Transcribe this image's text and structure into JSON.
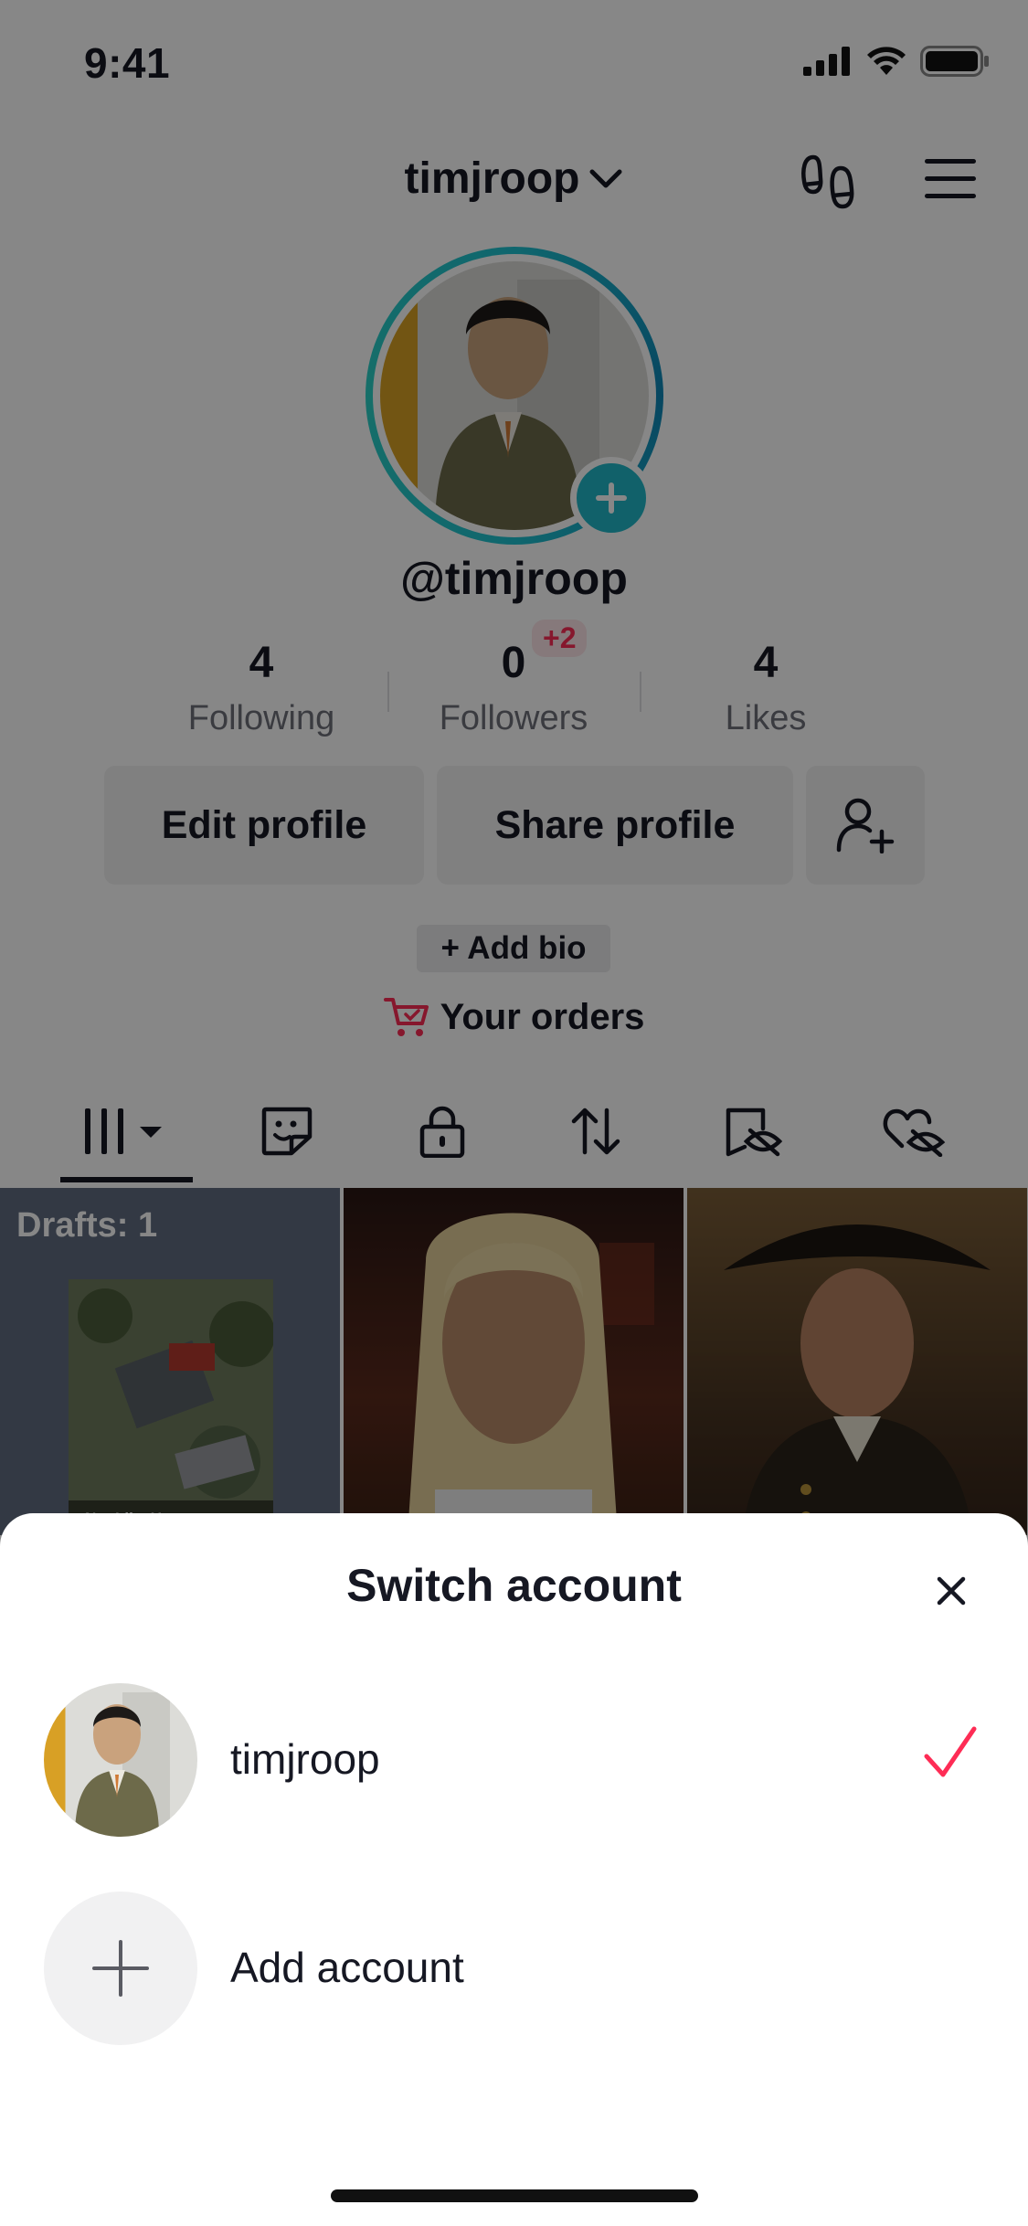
{
  "status_bar": {
    "time": "9:41"
  },
  "header": {
    "username": "timjroop"
  },
  "profile": {
    "handle": "@timjroop",
    "stats": [
      {
        "value": "4",
        "label": "Following"
      },
      {
        "value": "0",
        "label": "Followers",
        "badge": "+2"
      },
      {
        "value": "4",
        "label": "Likes"
      }
    ],
    "buttons": {
      "edit": "Edit profile",
      "share": "Share profile"
    },
    "add_bio": "+ Add bio",
    "orders": "Your orders"
  },
  "grid": {
    "drafts_label": "Drafts: 1",
    "draft_caption": "Not Like Us"
  },
  "sheet": {
    "title": "Switch account",
    "accounts": [
      {
        "name": "timjroop",
        "selected": true
      }
    ],
    "add_account": "Add account"
  },
  "colors": {
    "accent": "#fe2c55",
    "teal": "#20b8c9",
    "overlay": "rgba(0,0,0,0.47)"
  },
  "icons": [
    "signal-icon",
    "wifi-icon",
    "battery-icon",
    "chevron-down-icon",
    "footprints-icon",
    "menu-icon",
    "plus-icon",
    "add-friend-icon",
    "cart-icon",
    "grid-icon",
    "repost-icon",
    "lock-icon",
    "favorites-icon",
    "hidden-icon",
    "liked-hidden-icon",
    "close-icon",
    "checkmark-icon"
  ]
}
